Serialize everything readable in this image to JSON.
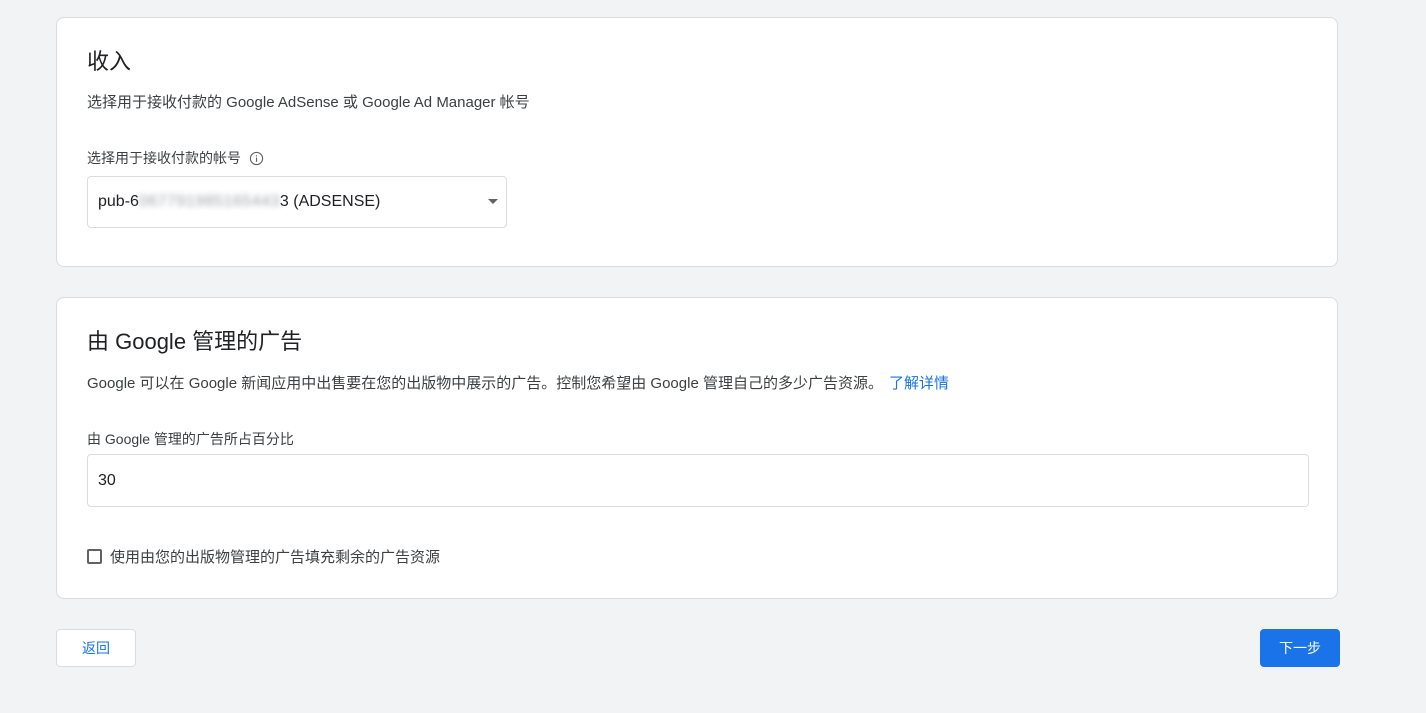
{
  "revenue": {
    "title": "收入",
    "description": "选择用于接收付款的 Google AdSense 或 Google Ad Manager 帐号",
    "account_label": "选择用于接收付款的帐号",
    "account_prefix": "pub-6",
    "account_masked": "067791985165443",
    "account_suffix": "3 (ADSENSE)"
  },
  "google_ads": {
    "title": "由 Google 管理的广告",
    "description": "Google 可以在 Google 新闻应用中出售要在您的出版物中展示的广告。控制您希望由 Google 管理自己的多少广告资源。",
    "learn_more": "了解详情",
    "percent_label": "由 Google 管理的广告所占百分比",
    "percent_value": "30",
    "fill_checkbox_label": "使用由您的出版物管理的广告填充剩余的广告资源",
    "fill_checkbox_checked": false
  },
  "footer": {
    "back_label": "返回",
    "next_label": "下一步"
  },
  "colors": {
    "accent": "#1a73e8",
    "background": "#f1f3f4",
    "border": "#dadce0"
  }
}
